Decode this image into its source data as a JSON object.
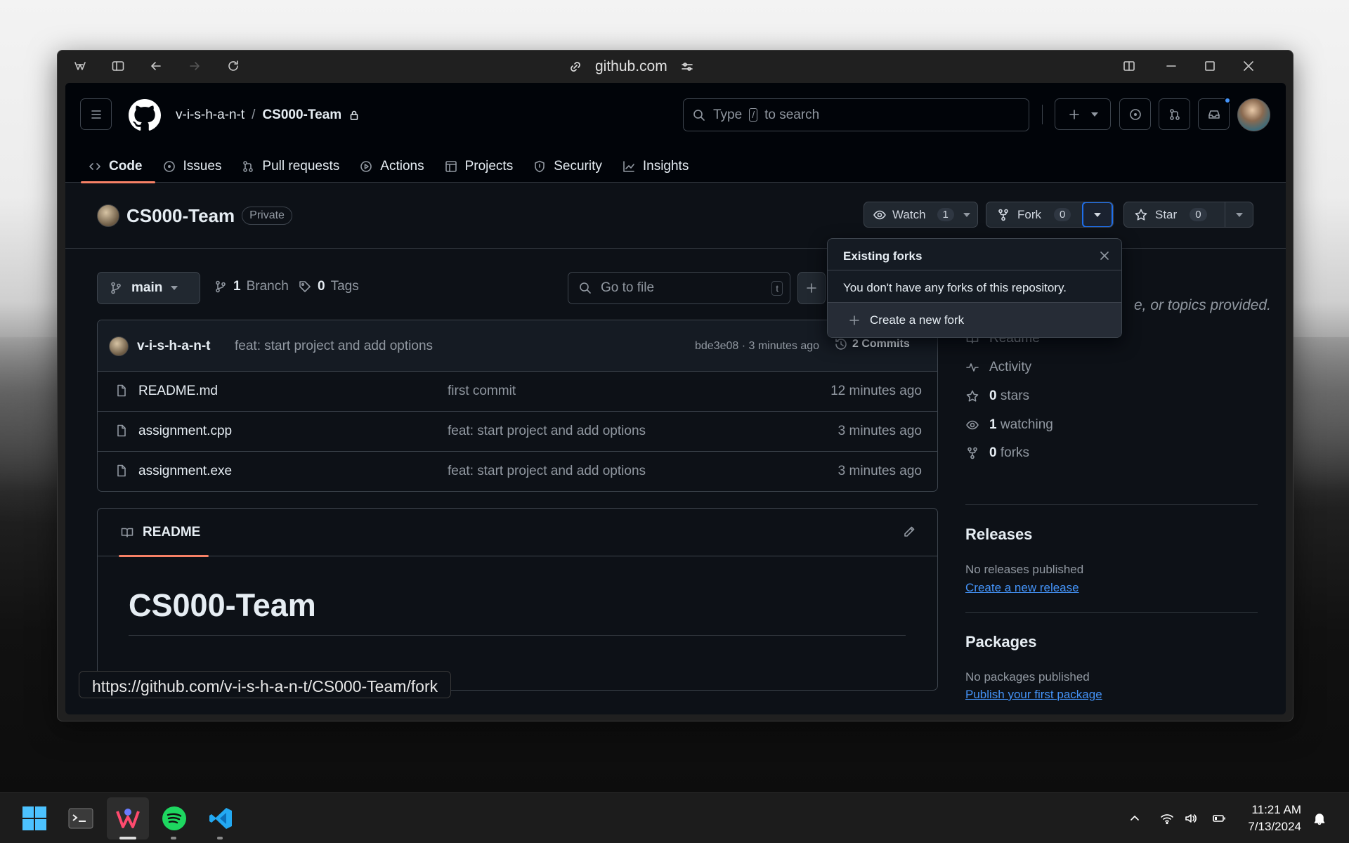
{
  "browser": {
    "url": "github.com"
  },
  "header": {
    "owner": "v-i-s-h-a-n-t",
    "separator": "/",
    "repo": "CS000-Team",
    "search_prefix": "Type",
    "search_key": "/",
    "search_suffix": "to search"
  },
  "tabs": [
    {
      "label": "Code"
    },
    {
      "label": "Issues"
    },
    {
      "label": "Pull requests"
    },
    {
      "label": "Actions"
    },
    {
      "label": "Projects"
    },
    {
      "label": "Security"
    },
    {
      "label": "Insights"
    }
  ],
  "repo": {
    "name": "CS000-Team",
    "visibility": "Private",
    "watch": {
      "label": "Watch",
      "count": "1"
    },
    "fork": {
      "label": "Fork",
      "count": "0"
    },
    "star": {
      "label": "Star",
      "count": "0"
    }
  },
  "branch": {
    "name": "main",
    "branches": "1",
    "branches_label": "Branch",
    "tags": "0",
    "tags_label": "Tags"
  },
  "gofile": {
    "placeholder": "Go to file",
    "key": "t"
  },
  "latest_commit": {
    "author": "v-i-s-h-a-n-t",
    "message": "feat: start project and add options",
    "meta": "bde3e08 · 3 minutes ago",
    "commits": "2 Commits"
  },
  "files": [
    {
      "name": "README.md",
      "message": "first commit",
      "time": "12 minutes ago"
    },
    {
      "name": "assignment.cpp",
      "message": "feat: start project and add options",
      "time": "3 minutes ago"
    },
    {
      "name": "assignment.exe",
      "message": "feat: start project and add options",
      "time": "3 minutes ago"
    }
  ],
  "readme": {
    "tab": "README",
    "heading": "CS000-Team"
  },
  "about": {
    "partial": "e, or topics provided.",
    "readme": "Readme",
    "activity": "Activity",
    "stars_n": "0",
    "stars": "stars",
    "watching_n": "1",
    "watching": "watching",
    "forks_n": "0",
    "forks": "forks"
  },
  "releases": {
    "title": "Releases",
    "none": "No releases published",
    "link": "Create a new release"
  },
  "packages": {
    "title": "Packages",
    "none": "No packages published",
    "link": "Publish your first package"
  },
  "forks_popup": {
    "title": "Existing forks",
    "message": "You don't have any forks of this repository.",
    "create": "Create a new fork"
  },
  "status_url": "https://github.com/v-i-s-h-a-n-t/CS000-Team/fork",
  "taskbar": {
    "time": "11:21 AM",
    "date": "7/13/2024"
  }
}
